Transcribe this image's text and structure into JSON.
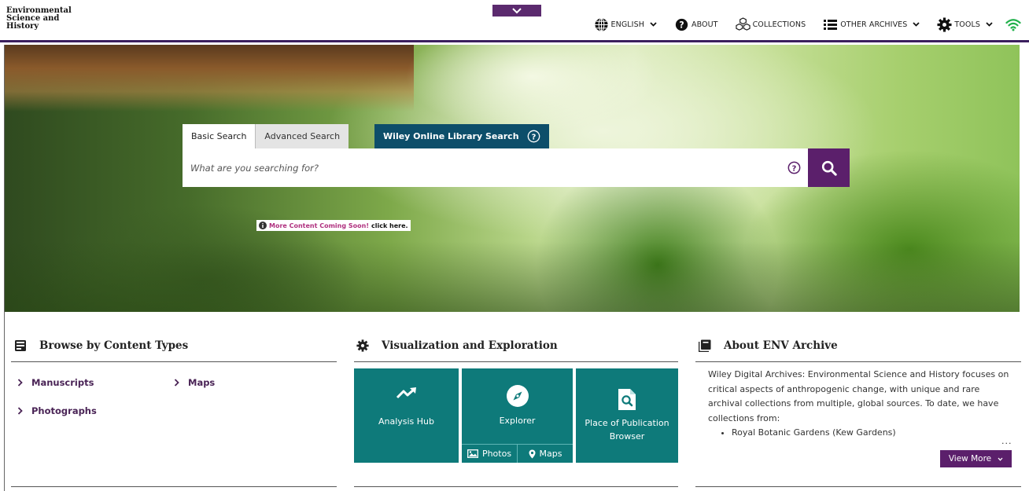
{
  "brand": {
    "line1": "Environmental",
    "line2": "Science and",
    "line3": "History"
  },
  "nav": {
    "language": "ENGLISH",
    "about": "ABOUT",
    "collections": "COLLECTIONS",
    "other_archives": "OTHER ARCHIVES",
    "tools": "TOOLS"
  },
  "search": {
    "tab_basic": "Basic Search",
    "tab_advanced": "Advanced Search",
    "tab_wiley": "Wiley Online Library Search",
    "placeholder": "What are you searching for?"
  },
  "notice": {
    "highlight": "More Content Coming Soon!",
    "link": "click here."
  },
  "browse": {
    "title": "Browse by Content Types",
    "items": [
      "Manuscripts",
      "Maps",
      "Photographs"
    ]
  },
  "visualization": {
    "title": "Visualization and Exploration",
    "analysis_hub": "Analysis Hub",
    "explorer": "Explorer",
    "explorer_photos": "Photos",
    "explorer_maps": "Maps",
    "place_line1": "Place of Publication",
    "place_line2": "Browser"
  },
  "about": {
    "title": "About ENV Archive",
    "text": "Wiley Digital Archives: Environmental Science and History focuses on critical aspects of anthropogenic change, with unique and rare archival collections from multiple, global sources. To date, we have collections from:",
    "bullet": "Royal Botanic Gardens (Kew Gardens)",
    "ellipsis": "...",
    "view_more": "View More"
  },
  "colors": {
    "brand_purple": "#5b1f6b",
    "teal": "#0e7a7a",
    "wiley_blue": "#0d4e6a",
    "wifi_green": "#22b14c"
  }
}
